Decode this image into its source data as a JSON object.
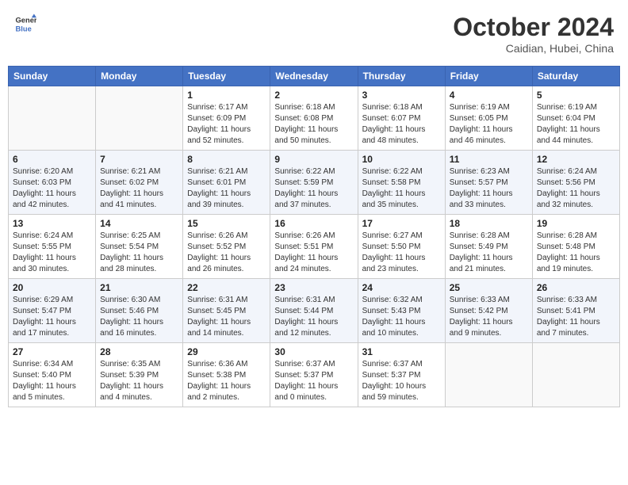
{
  "header": {
    "logo_line1": "General",
    "logo_line2": "Blue",
    "month_title": "October 2024",
    "subtitle": "Caidian, Hubei, China"
  },
  "weekdays": [
    "Sunday",
    "Monday",
    "Tuesday",
    "Wednesday",
    "Thursday",
    "Friday",
    "Saturday"
  ],
  "weeks": [
    [
      {
        "day": "",
        "sunrise": "",
        "sunset": "",
        "daylight": ""
      },
      {
        "day": "",
        "sunrise": "",
        "sunset": "",
        "daylight": ""
      },
      {
        "day": "1",
        "sunrise": "Sunrise: 6:17 AM",
        "sunset": "Sunset: 6:09 PM",
        "daylight": "Daylight: 11 hours and 52 minutes."
      },
      {
        "day": "2",
        "sunrise": "Sunrise: 6:18 AM",
        "sunset": "Sunset: 6:08 PM",
        "daylight": "Daylight: 11 hours and 50 minutes."
      },
      {
        "day": "3",
        "sunrise": "Sunrise: 6:18 AM",
        "sunset": "Sunset: 6:07 PM",
        "daylight": "Daylight: 11 hours and 48 minutes."
      },
      {
        "day": "4",
        "sunrise": "Sunrise: 6:19 AM",
        "sunset": "Sunset: 6:05 PM",
        "daylight": "Daylight: 11 hours and 46 minutes."
      },
      {
        "day": "5",
        "sunrise": "Sunrise: 6:19 AM",
        "sunset": "Sunset: 6:04 PM",
        "daylight": "Daylight: 11 hours and 44 minutes."
      }
    ],
    [
      {
        "day": "6",
        "sunrise": "Sunrise: 6:20 AM",
        "sunset": "Sunset: 6:03 PM",
        "daylight": "Daylight: 11 hours and 42 minutes."
      },
      {
        "day": "7",
        "sunrise": "Sunrise: 6:21 AM",
        "sunset": "Sunset: 6:02 PM",
        "daylight": "Daylight: 11 hours and 41 minutes."
      },
      {
        "day": "8",
        "sunrise": "Sunrise: 6:21 AM",
        "sunset": "Sunset: 6:01 PM",
        "daylight": "Daylight: 11 hours and 39 minutes."
      },
      {
        "day": "9",
        "sunrise": "Sunrise: 6:22 AM",
        "sunset": "Sunset: 5:59 PM",
        "daylight": "Daylight: 11 hours and 37 minutes."
      },
      {
        "day": "10",
        "sunrise": "Sunrise: 6:22 AM",
        "sunset": "Sunset: 5:58 PM",
        "daylight": "Daylight: 11 hours and 35 minutes."
      },
      {
        "day": "11",
        "sunrise": "Sunrise: 6:23 AM",
        "sunset": "Sunset: 5:57 PM",
        "daylight": "Daylight: 11 hours and 33 minutes."
      },
      {
        "day": "12",
        "sunrise": "Sunrise: 6:24 AM",
        "sunset": "Sunset: 5:56 PM",
        "daylight": "Daylight: 11 hours and 32 minutes."
      }
    ],
    [
      {
        "day": "13",
        "sunrise": "Sunrise: 6:24 AM",
        "sunset": "Sunset: 5:55 PM",
        "daylight": "Daylight: 11 hours and 30 minutes."
      },
      {
        "day": "14",
        "sunrise": "Sunrise: 6:25 AM",
        "sunset": "Sunset: 5:54 PM",
        "daylight": "Daylight: 11 hours and 28 minutes."
      },
      {
        "day": "15",
        "sunrise": "Sunrise: 6:26 AM",
        "sunset": "Sunset: 5:52 PM",
        "daylight": "Daylight: 11 hours and 26 minutes."
      },
      {
        "day": "16",
        "sunrise": "Sunrise: 6:26 AM",
        "sunset": "Sunset: 5:51 PM",
        "daylight": "Daylight: 11 hours and 24 minutes."
      },
      {
        "day": "17",
        "sunrise": "Sunrise: 6:27 AM",
        "sunset": "Sunset: 5:50 PM",
        "daylight": "Daylight: 11 hours and 23 minutes."
      },
      {
        "day": "18",
        "sunrise": "Sunrise: 6:28 AM",
        "sunset": "Sunset: 5:49 PM",
        "daylight": "Daylight: 11 hours and 21 minutes."
      },
      {
        "day": "19",
        "sunrise": "Sunrise: 6:28 AM",
        "sunset": "Sunset: 5:48 PM",
        "daylight": "Daylight: 11 hours and 19 minutes."
      }
    ],
    [
      {
        "day": "20",
        "sunrise": "Sunrise: 6:29 AM",
        "sunset": "Sunset: 5:47 PM",
        "daylight": "Daylight: 11 hours and 17 minutes."
      },
      {
        "day": "21",
        "sunrise": "Sunrise: 6:30 AM",
        "sunset": "Sunset: 5:46 PM",
        "daylight": "Daylight: 11 hours and 16 minutes."
      },
      {
        "day": "22",
        "sunrise": "Sunrise: 6:31 AM",
        "sunset": "Sunset: 5:45 PM",
        "daylight": "Daylight: 11 hours and 14 minutes."
      },
      {
        "day": "23",
        "sunrise": "Sunrise: 6:31 AM",
        "sunset": "Sunset: 5:44 PM",
        "daylight": "Daylight: 11 hours and 12 minutes."
      },
      {
        "day": "24",
        "sunrise": "Sunrise: 6:32 AM",
        "sunset": "Sunset: 5:43 PM",
        "daylight": "Daylight: 11 hours and 10 minutes."
      },
      {
        "day": "25",
        "sunrise": "Sunrise: 6:33 AM",
        "sunset": "Sunset: 5:42 PM",
        "daylight": "Daylight: 11 hours and 9 minutes."
      },
      {
        "day": "26",
        "sunrise": "Sunrise: 6:33 AM",
        "sunset": "Sunset: 5:41 PM",
        "daylight": "Daylight: 11 hours and 7 minutes."
      }
    ],
    [
      {
        "day": "27",
        "sunrise": "Sunrise: 6:34 AM",
        "sunset": "Sunset: 5:40 PM",
        "daylight": "Daylight: 11 hours and 5 minutes."
      },
      {
        "day": "28",
        "sunrise": "Sunrise: 6:35 AM",
        "sunset": "Sunset: 5:39 PM",
        "daylight": "Daylight: 11 hours and 4 minutes."
      },
      {
        "day": "29",
        "sunrise": "Sunrise: 6:36 AM",
        "sunset": "Sunset: 5:38 PM",
        "daylight": "Daylight: 11 hours and 2 minutes."
      },
      {
        "day": "30",
        "sunrise": "Sunrise: 6:37 AM",
        "sunset": "Sunset: 5:37 PM",
        "daylight": "Daylight: 11 hours and 0 minutes."
      },
      {
        "day": "31",
        "sunrise": "Sunrise: 6:37 AM",
        "sunset": "Sunset: 5:37 PM",
        "daylight": "Daylight: 10 hours and 59 minutes."
      },
      {
        "day": "",
        "sunrise": "",
        "sunset": "",
        "daylight": ""
      },
      {
        "day": "",
        "sunrise": "",
        "sunset": "",
        "daylight": ""
      }
    ]
  ]
}
